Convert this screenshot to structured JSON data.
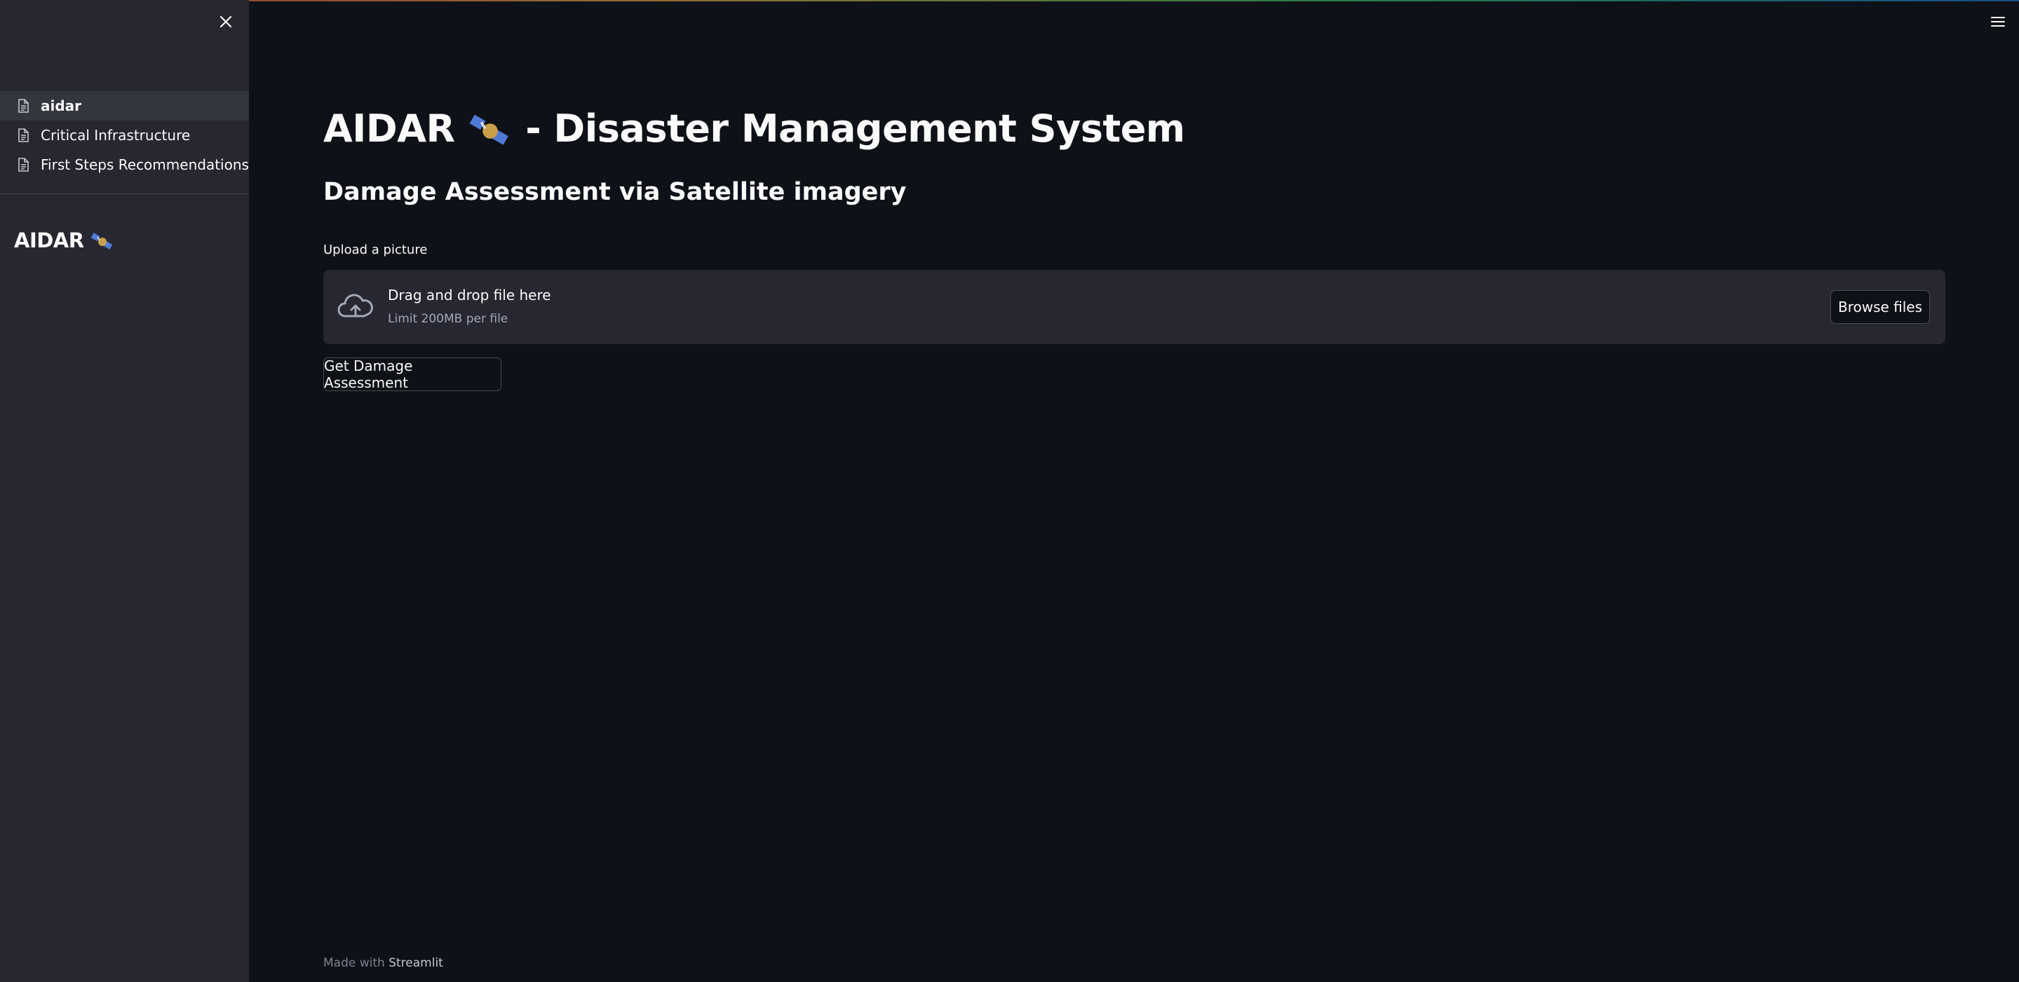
{
  "sidebar": {
    "items": [
      {
        "label": "aidar",
        "active": true
      },
      {
        "label": "Critical Infrastructure",
        "active": false
      },
      {
        "label": "First Steps Recommendations",
        "active": false
      }
    ],
    "title": "AIDAR"
  },
  "main": {
    "title_prefix": "AIDAR",
    "title_suffix": "- Disaster Management System",
    "subtitle": "Damage Assessment via Satellite imagery",
    "upload_label": "Upload a picture",
    "dropzone": {
      "primary": "Drag and drop file here",
      "secondary": "Limit 200MB per file",
      "browse_label": "Browse files"
    },
    "action_button": "Get Damage Assessment"
  },
  "footer": {
    "prefix": "Made with",
    "brand": "Streamlit"
  },
  "icons": {
    "close": "close-icon",
    "menu": "hamburger-menu-icon",
    "page": "document-icon",
    "upload": "cloud-upload-icon",
    "title_emoji": "satellite-icon"
  },
  "colors": {
    "background": "#0e1117",
    "sidebar": "#262730",
    "text": "#fafafa",
    "muted": "#a3a8b8"
  }
}
